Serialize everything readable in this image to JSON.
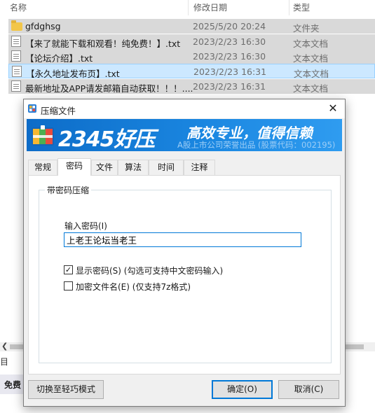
{
  "explorer": {
    "columns": {
      "name": "名称",
      "date": "修改日期",
      "type": "类型"
    },
    "files": [
      {
        "name": "gfdghsg",
        "date": "2025/5/20 20:24",
        "type": "文件夹",
        "icon": "folder-icon"
      },
      {
        "name": "【来了就能下载和观看！纯免费！】.txt",
        "date": "2023/2/23 16:30",
        "type": "文本文档",
        "icon": "text-file-icon"
      },
      {
        "name": "【论坛介绍】.txt",
        "date": "2023/2/23 16:30",
        "type": "文本文档",
        "icon": "text-file-icon"
      },
      {
        "name": "【永久地址发布页】.txt",
        "date": "2023/2/23 16:31",
        "type": "文本文档",
        "icon": "text-file-icon"
      },
      {
        "name": "最新地址及APP请发邮箱自动获取！！！....",
        "date": "2023/2/23 16:31",
        "type": "文本文档",
        "icon": "text-file-icon"
      }
    ],
    "side_label": "目",
    "bottom_chip": "免费"
  },
  "dialog": {
    "title": "压缩文件",
    "banner": {
      "brand": "2345好压",
      "slogan": "高效专业，值得信赖",
      "sub": "A股上市公司荣誉出品 (股票代码：002195)"
    },
    "tabs": [
      "常规",
      "密码",
      "文件",
      "算法",
      "时间",
      "注释"
    ],
    "active_tab": "密码",
    "group_title": "带密码压缩",
    "password_label": "输入密码(I)",
    "password_value": "上老王论坛当老王",
    "show_password": {
      "label": "显示密码(S) (勾选可支持中文密码输入)",
      "checked": true,
      "mark": "✓"
    },
    "encrypt_names": {
      "label": "加密文件名(E) (仅支持7z格式)",
      "checked": false,
      "mark": ""
    },
    "buttons": {
      "switch_mode": "切换至轻巧模式",
      "ok": "确定(O)",
      "cancel": "取消(C)"
    },
    "colors": {
      "accent": "#0078d7",
      "banner": "#1a86e0"
    }
  }
}
